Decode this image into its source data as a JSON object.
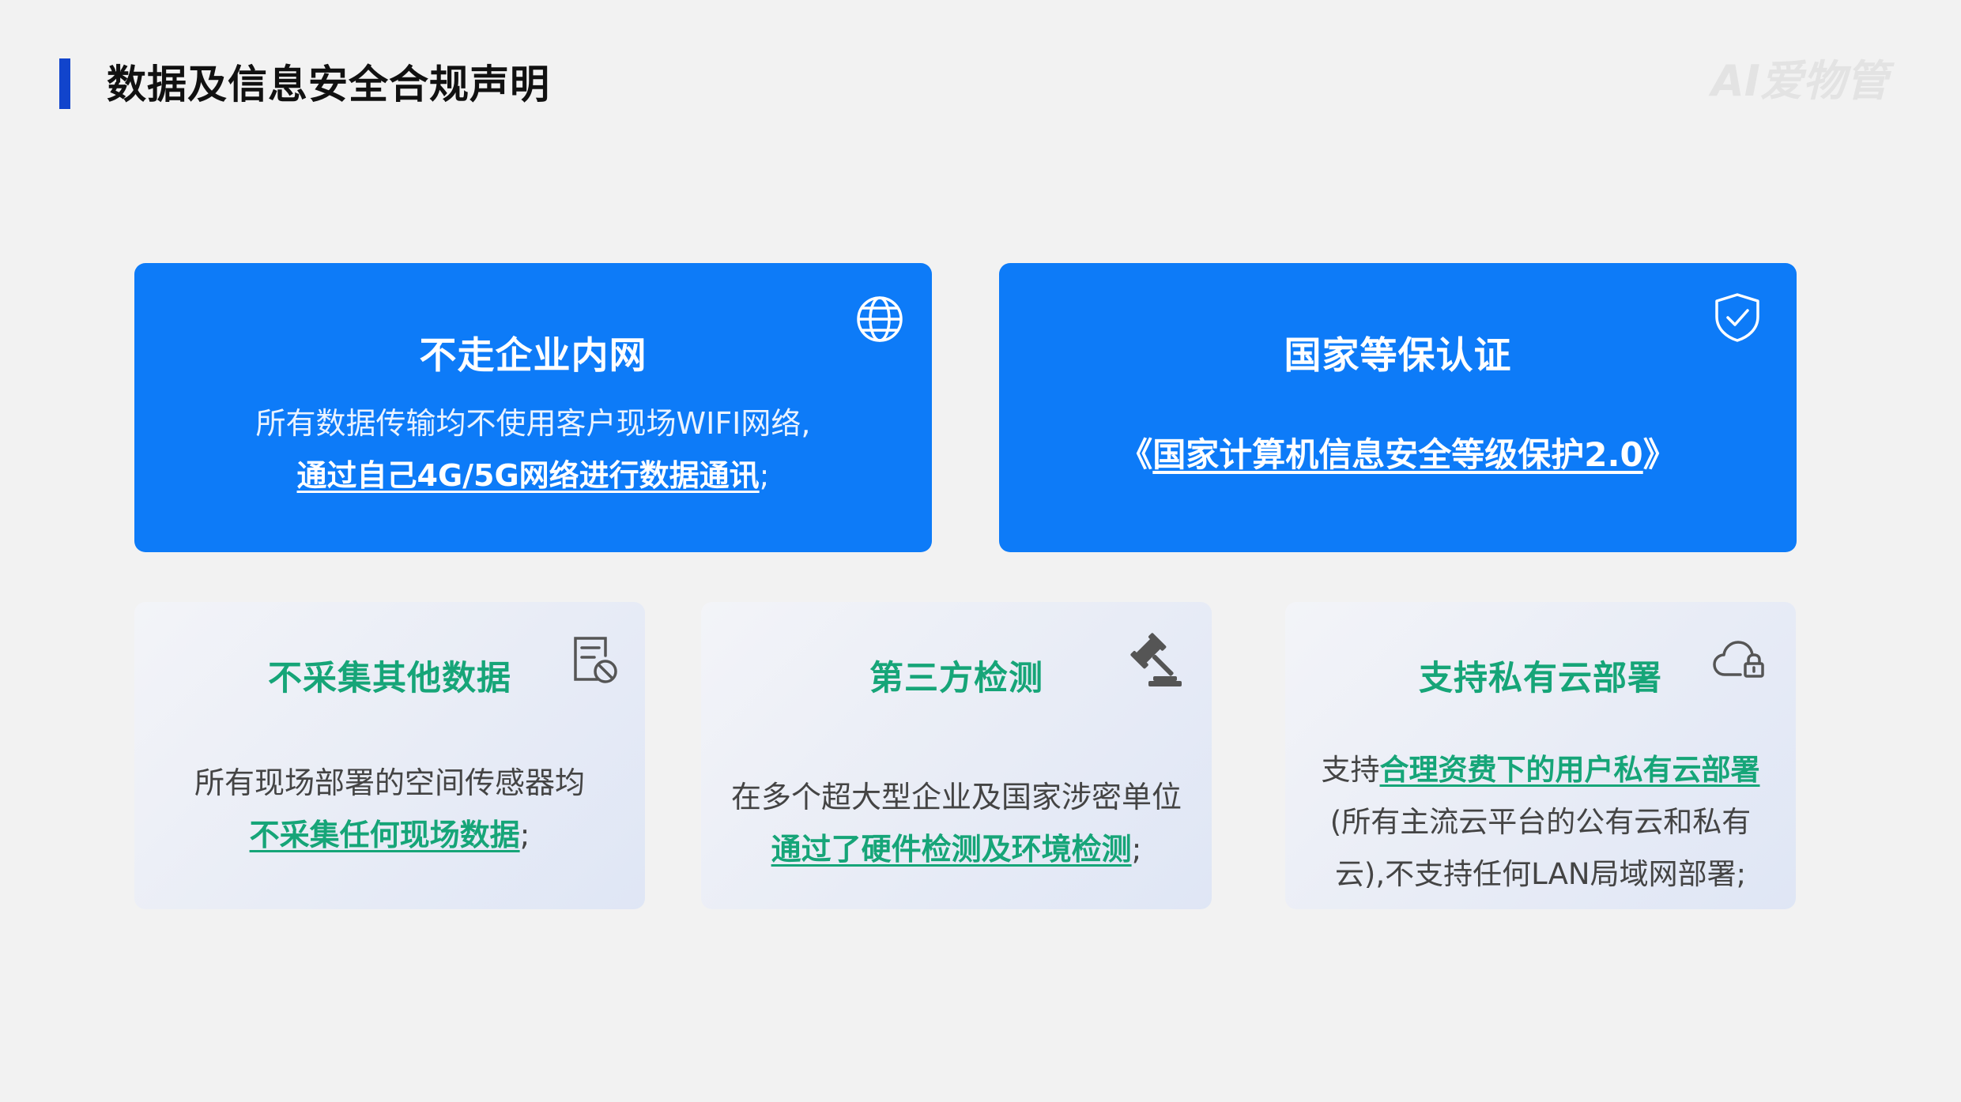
{
  "page": {
    "title": "数据及信息安全合规声明",
    "logo_text": "AI爱物管"
  },
  "colors": {
    "accent_bar": "#1144cc",
    "blue_card": "#0d7bf8",
    "green_highlight": "#16a578",
    "background": "#f2f2f2"
  },
  "cards": {
    "no_intranet": {
      "title": "不走企业内网",
      "icon": "globe-icon",
      "line1": "所有数据传输均不使用客户现场WIFI网络,",
      "highlight": "通过自己4G/5G网络进行数据通讯",
      "suffix": ";"
    },
    "certification": {
      "title": "国家等保认证",
      "icon": "shield-check-icon",
      "prefix": "《",
      "highlight": "国家计算机信息安全等级保护2.0",
      "suffix": "》"
    },
    "no_collect": {
      "title": "不采集其他数据",
      "icon": "document-block-icon",
      "line1": "所有现场部署的空间传感器均",
      "highlight": "不采集任何现场数据",
      "suffix": ";"
    },
    "third_party": {
      "title": "第三方检测",
      "icon": "gavel-icon",
      "line1": "在多个超大型企业及国家涉密单位",
      "highlight": "通过了硬件检测及环境检测",
      "suffix": ";"
    },
    "private_cloud": {
      "title": "支持私有云部署",
      "icon": "cloud-lock-icon",
      "prefix": "支持",
      "highlight": "合理资费下的用户私有云部署",
      "line2": "(所有主流云平台的公有云和私有",
      "line3": "云),不支持任何LAN局域网部署;"
    }
  }
}
